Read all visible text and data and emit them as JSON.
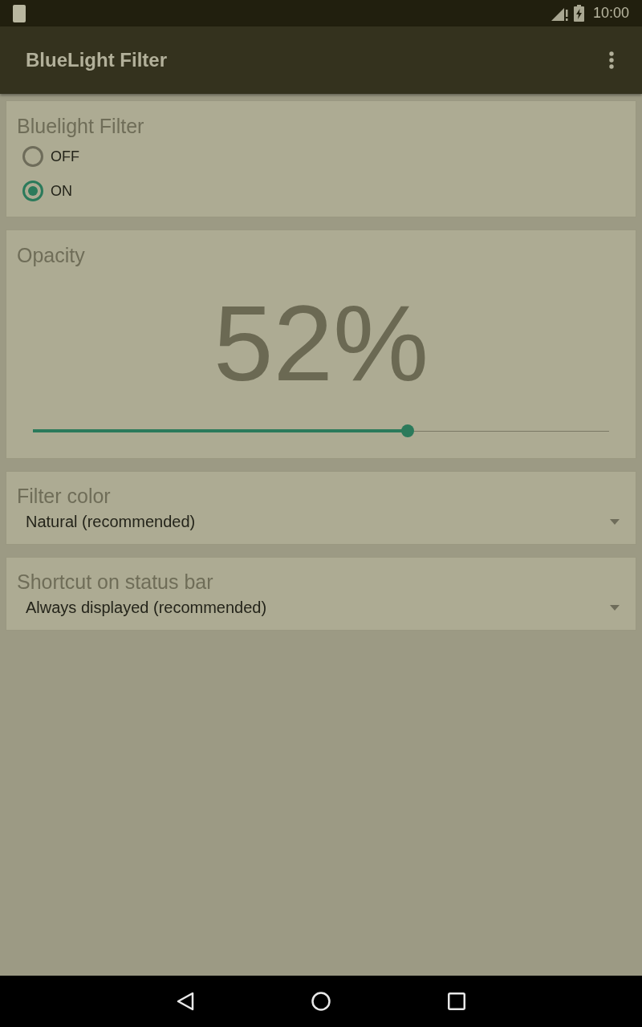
{
  "status_bar": {
    "time": "10:00"
  },
  "app_bar": {
    "title": "BlueLight Filter"
  },
  "filter_card": {
    "title": "Bluelight Filter",
    "options": [
      {
        "label": "OFF",
        "selected": false
      },
      {
        "label": "ON",
        "selected": true
      }
    ]
  },
  "opacity_card": {
    "title": "Opacity",
    "value": "52%",
    "slider": {
      "level": 0.65
    }
  },
  "dropdowns": [
    {
      "label": "Filter color",
      "value": "Natural (recommended)"
    },
    {
      "label": "Shortcut on status bar",
      "value": "Always displayed (recommended)"
    }
  ]
}
